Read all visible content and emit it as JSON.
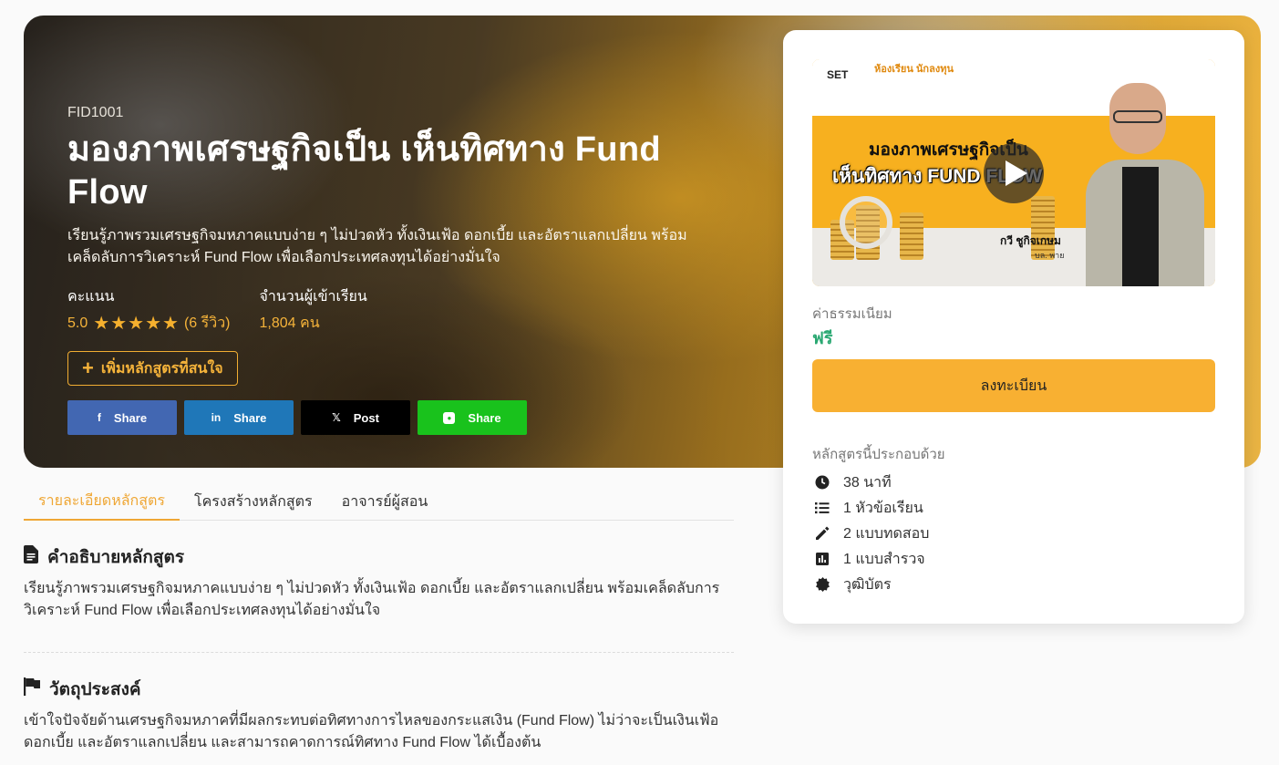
{
  "course": {
    "code": "FID1001",
    "title": "มองภาพเศรษฐกิจเป็น เห็นทิศทาง Fund Flow",
    "subtitle": "เรียนรู้ภาพรวมเศรษฐกิจมหภาคแบบง่าย ๆ ไม่ปวดหัว ทั้งเงินเฟ้อ ดอกเบี้ย และอัตราแลกเปลี่ยน พร้อมเคล็ดลับการวิเคราะห์ Fund Flow เพื่อเลือกประเทศลงทุนได้อย่างมั่นใจ"
  },
  "rating": {
    "label": "คะแนน",
    "score": "5.0",
    "stars": 5,
    "reviews": "(6 รีวิว)"
  },
  "enrollment": {
    "label": "จำนวนผู้เข้าเรียน",
    "value": "1,804 คน"
  },
  "wishlist": {
    "label": "เพิ่มหลักสูตรที่สนใจ"
  },
  "share": [
    {
      "network": "facebook",
      "icon": "f",
      "label": "Share",
      "color": "#4267b2"
    },
    {
      "network": "linkedin",
      "icon": "in",
      "label": "Share",
      "color": "#1f77b8"
    },
    {
      "network": "x",
      "icon": "𝕏",
      "label": "Post",
      "color": "#000000"
    },
    {
      "network": "line",
      "icon": "LINE",
      "label": "Share",
      "color": "#19c21c"
    }
  ],
  "thumbnail": {
    "brand": "SET",
    "brand2": "ห้องเรียน นักลงทุน",
    "line1": "มองภาพเศรษฐกิจเป็น",
    "line2": "เห็นทิศทาง FUND FLOW",
    "presenter": "กวี ชูกิจเกษม",
    "presenter_org": "บล. พาย"
  },
  "pricing": {
    "fee_label": "ค่าธรรมเนียม",
    "fee_value": "ฟรี",
    "enroll_label": "ลงทะเบียน"
  },
  "includes": {
    "title": "หลักสูตรนี้ประกอบด้วย",
    "items": [
      {
        "icon": "clock-icon",
        "text": "38 นาที"
      },
      {
        "icon": "list-icon",
        "text": "1 หัวข้อเรียน"
      },
      {
        "icon": "pencil-icon",
        "text": "2 แบบทดสอบ"
      },
      {
        "icon": "poll-icon",
        "text": "1 แบบสำรวจ"
      },
      {
        "icon": "badge-icon",
        "text": "วุฒิบัตร"
      }
    ]
  },
  "tabs": [
    {
      "label": "รายละเอียดหลักสูตร",
      "active": true
    },
    {
      "label": "โครงสร้างหลักสูตร",
      "active": false
    },
    {
      "label": "อาจารย์ผู้สอน",
      "active": false
    }
  ],
  "description": {
    "heading": "คำอธิบายหลักสูตร",
    "body": "เรียนรู้ภาพรวมเศรษฐกิจมหภาคแบบง่าย ๆ ไม่ปวดหัว ทั้งเงินเฟ้อ ดอกเบี้ย และอัตราแลกเปลี่ยน พร้อมเคล็ดลับการวิเคราะห์ Fund Flow เพื่อเลือกประเทศลงทุนได้อย่างมั่นใจ"
  },
  "objective": {
    "heading": "วัตถุประสงค์",
    "body": "เข้าใจปัจจัยด้านเศรษฐกิจมหภาคที่มีผลกระทบต่อทิศทางการไหลของกระแสเงิน (Fund Flow) ไม่ว่าจะเป็นเงินเฟ้อ ดอกเบี้ย และอัตราแลกเปลี่ยน และสามารถคาดการณ์ทิศทาง Fund Flow ได้เบื้องต้น"
  },
  "colors": {
    "accent": "#f8b032",
    "free": "#2aa872",
    "tab_active": "#efa735"
  }
}
